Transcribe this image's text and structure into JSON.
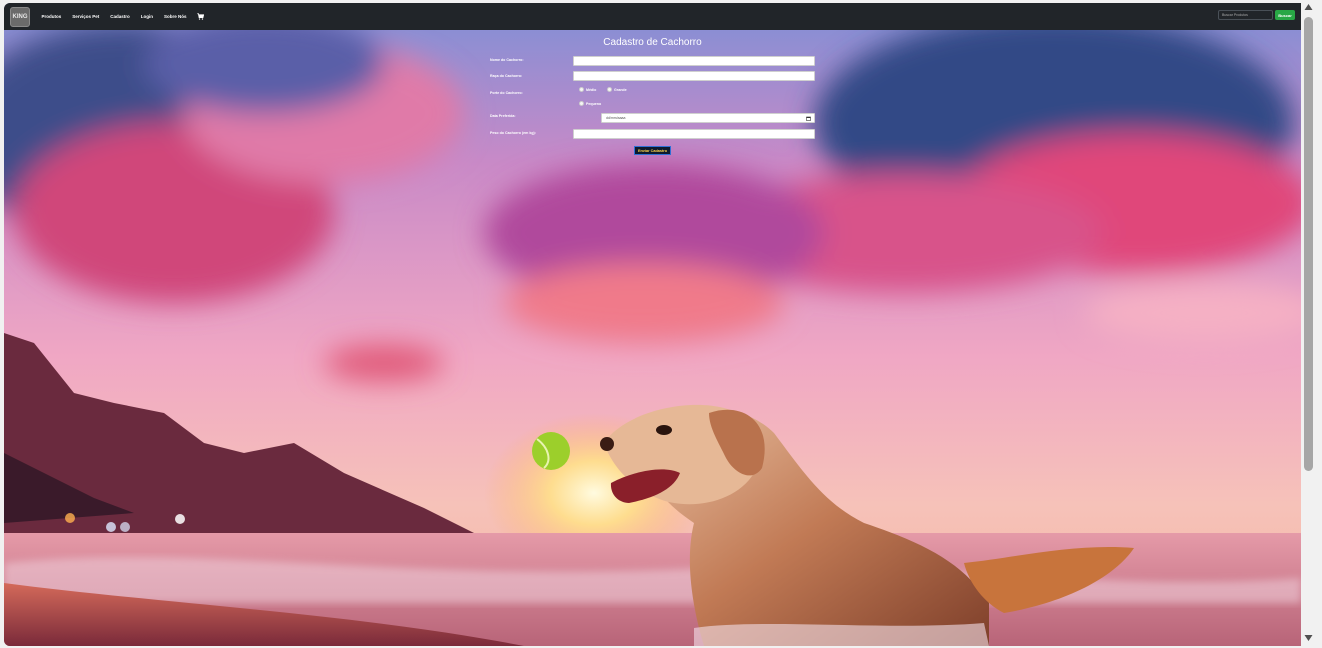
{
  "navbar": {
    "logo_text": "KING",
    "links": [
      "Produtos",
      "Serviços Pet",
      "Cadastro",
      "Login",
      "Sobre Nós"
    ],
    "cart_icon": "cart-icon",
    "search_placeholder": "Buscar Produtos",
    "search_button": "Buscar"
  },
  "form": {
    "title": "Cadastro de Cachorro",
    "name_label": "Nome do Cachorro:",
    "breed_label": "Raça do Cachorro:",
    "size_label": "Porte do Cachorro:",
    "size_options": [
      "Médio",
      "Grande",
      "Pequeno"
    ],
    "date_label": "Data Preferida:",
    "date_placeholder": "dd/mm/aaaa",
    "weight_label": "Peso do Cachorro (em kg):",
    "submit_label": "Enviar Cadastro"
  },
  "colors": {
    "navbar_bg": "#212529",
    "search_button_bg": "#28a745",
    "submit_bg": "#0d1a2e",
    "submit_text": "#ffd54a"
  }
}
